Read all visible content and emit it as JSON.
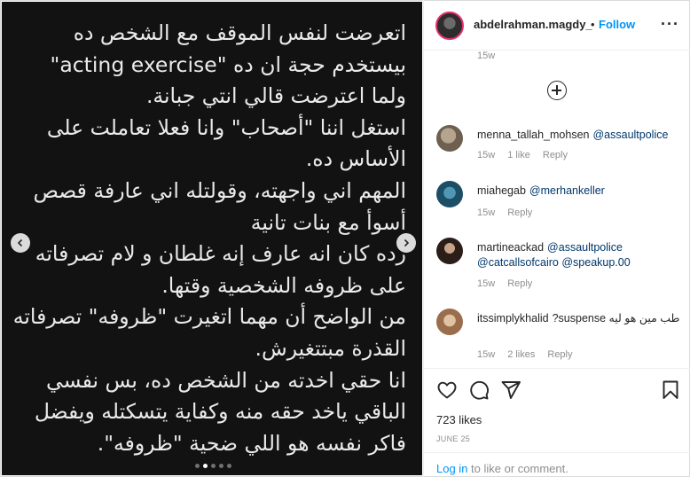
{
  "post": {
    "text_lines": [
      "اتعرضت لنفس الموقف مع الشخص ده",
      "بيستخدم حجة ان ده \"acting exercise\"",
      "ولما اعترضت قالي انتي جبانة.",
      "استغل اننا \"أصحاب\" وانا فعلا تعاملت على",
      "الأساس ده.",
      "المهم اني واجهته، وقولتله اني عارفة قصص",
      "أسوأ مع بنات تانية",
      "رده كان انه عارف إنه غلطان و لام تصرفاته",
      "على ظروفه الشخصية وقتها.",
      "من الواضح أن مهما اتغيرت \"ظروفه\" تصرفاته",
      "القذرة مبتتغيرش.",
      "انا حقي اخدته من الشخص ده، بس نفسي",
      "الباقي ياخد حقه منه وكفاية يتسكتله ويفضل",
      "فاكر نفسه هو اللي ضحية \"ظروفه\"."
    ],
    "carousel": {
      "total": 5,
      "active": 1
    }
  },
  "header": {
    "username": "abdelrahman.magdy_",
    "separator": "•",
    "follow_label": "Follow",
    "more_icon": "more-horizontal-icon"
  },
  "comments": {
    "previous_time": "15w",
    "items": [
      {
        "username": "menna_tallah_mohsen",
        "text": "@assaultpolice",
        "time": "15w",
        "likes": "1 like",
        "reply": "Reply",
        "avatar_color": "#8a7a68"
      },
      {
        "username": "miahegab",
        "text": "@merhankeller",
        "time": "15w",
        "likes": "",
        "reply": "Reply",
        "avatar_color": "#2a6f8f"
      },
      {
        "username": "martineackad",
        "text": "@assaultpolice @catcallsofcairo @speakup.00",
        "time": "15w",
        "likes": "",
        "reply": "Reply",
        "avatar_color": "#3a2a24"
      },
      {
        "username": "itssimplykhalid",
        "text": "طب مين هو ليه suspense?",
        "time": "15w",
        "likes": "2 likes",
        "reply": "Reply",
        "avatar_color": "#c9a27a"
      }
    ]
  },
  "actions": {
    "likes": "723 likes",
    "date": "JUNE 25",
    "icons": [
      "heart-icon",
      "comment-icon",
      "share-icon",
      "bookmark-icon"
    ]
  },
  "login": {
    "link": "Log in",
    "rest": " to like or comment."
  },
  "colors": {
    "accent_blue": "#0095f6",
    "mention_blue": "#00376b",
    "media_bg": "#121212",
    "muted": "#8e8e8e"
  }
}
